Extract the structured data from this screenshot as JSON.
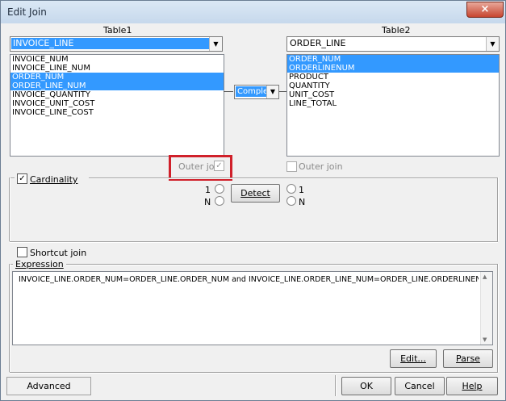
{
  "window": {
    "title": "Edit Join",
    "close_label": "×"
  },
  "table1": {
    "label": "Table1",
    "selected": "INVOICE_LINE",
    "items": [
      {
        "label": "INVOICE_NUM",
        "selected": false
      },
      {
        "label": "INVOICE_LINE_NUM",
        "selected": false
      },
      {
        "label": "ORDER_NUM",
        "selected": true
      },
      {
        "label": "ORDER_LINE_NUM",
        "selected": true
      },
      {
        "label": "INVOICE_QUANTITY",
        "selected": false
      },
      {
        "label": "INVOICE_UNIT_COST",
        "selected": false
      },
      {
        "label": "INVOICE_LINE_COST",
        "selected": false
      }
    ],
    "outer_join_label": "Outer join"
  },
  "table2": {
    "label": "Table2",
    "selected": "ORDER_LINE",
    "items": [
      {
        "label": "ORDER_NUM",
        "selected": true
      },
      {
        "label": "ORDERLINENUM",
        "selected": true
      },
      {
        "label": "PRODUCT",
        "selected": false
      },
      {
        "label": "QUANTITY",
        "selected": false
      },
      {
        "label": "UNIT_COST",
        "selected": false
      },
      {
        "label": "LINE_TOTAL",
        "selected": false
      }
    ],
    "outer_join_label": "Outer join"
  },
  "operator": {
    "value": "Complex"
  },
  "cardinality": {
    "label": "Cardinality",
    "checked": true,
    "left_one": "1",
    "left_n": "N",
    "right_one": "1",
    "right_n": "N",
    "detect_label": "Detect"
  },
  "shortcut_join": {
    "label": "Shortcut join",
    "checked": false
  },
  "expression": {
    "label": "Expression",
    "value": "INVOICE_LINE.ORDER_NUM=ORDER_LINE.ORDER_NUM and INVOICE_LINE.ORDER_LINE_NUM=ORDER_LINE.ORDERLINENUM",
    "edit_label": "Edit...",
    "parse_label": "Parse"
  },
  "footer": {
    "advanced_label": "Advanced",
    "ok_label": "OK",
    "cancel_label": "Cancel",
    "help_label": "Help"
  },
  "icons": {
    "dropdown": "chevron-down-icon",
    "check": "checkmark-icon"
  },
  "colors": {
    "selection": "#3399ff",
    "highlight_box": "#d0202a"
  }
}
